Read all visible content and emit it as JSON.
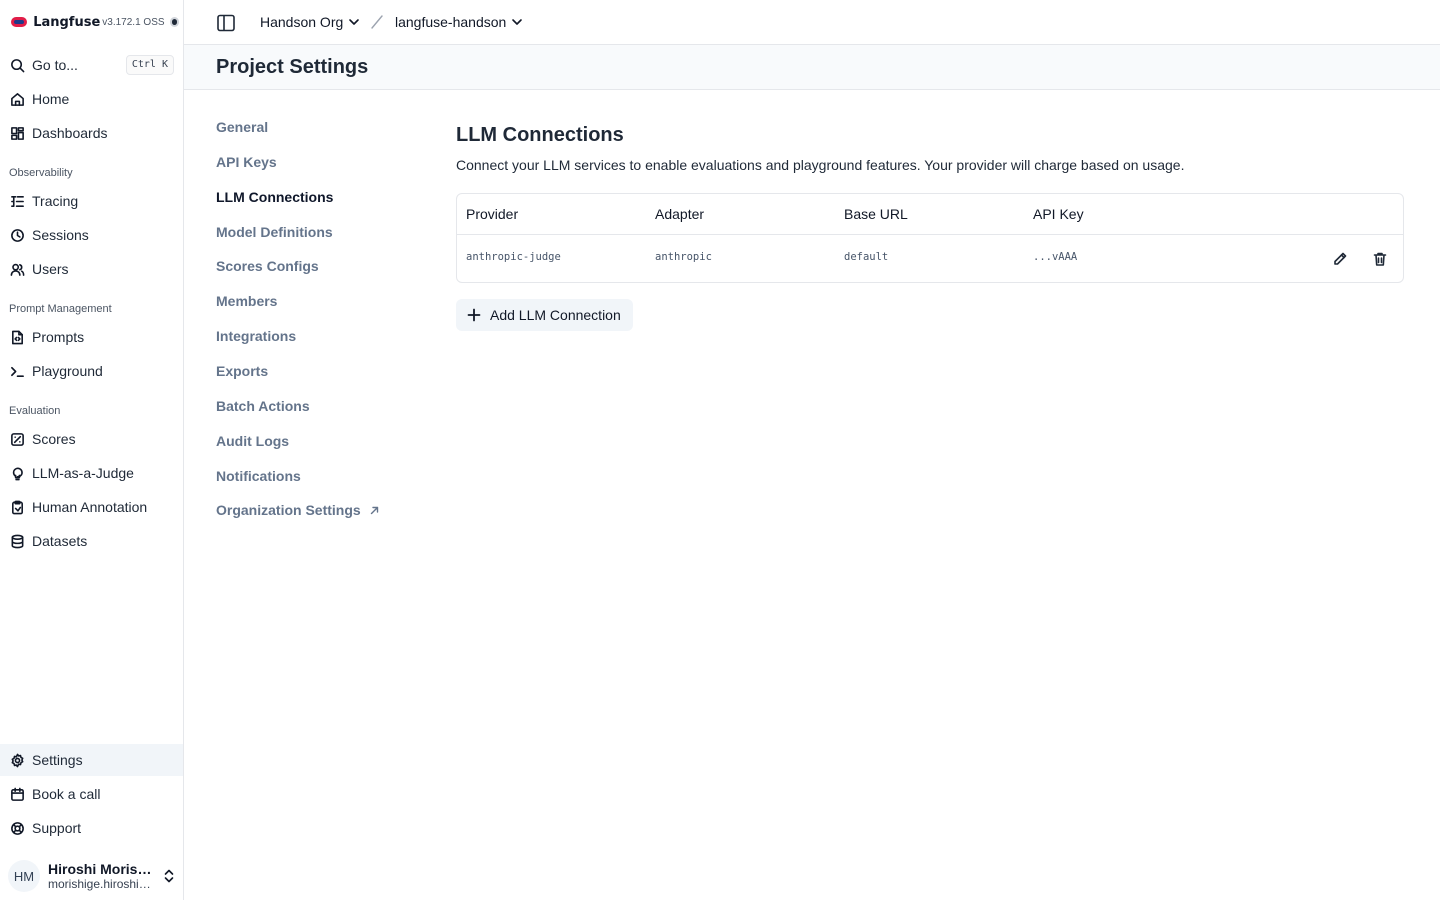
{
  "brand": {
    "name": "Langfuse",
    "version": "v3.172.1 OSS"
  },
  "sidebar": {
    "goto": {
      "label": "Go to...",
      "shortcut": "Ctrl K"
    },
    "top_items": [
      {
        "label": "Home",
        "icon": "home-icon"
      },
      {
        "label": "Dashboards",
        "icon": "dashboard-icon"
      }
    ],
    "sections": [
      {
        "label": "Observability",
        "items": [
          {
            "label": "Tracing",
            "icon": "tracing-icon"
          },
          {
            "label": "Sessions",
            "icon": "clock-icon"
          },
          {
            "label": "Users",
            "icon": "users-icon"
          }
        ]
      },
      {
        "label": "Prompt Management",
        "items": [
          {
            "label": "Prompts",
            "icon": "file-code-icon"
          },
          {
            "label": "Playground",
            "icon": "terminal-icon"
          }
        ]
      },
      {
        "label": "Evaluation",
        "items": [
          {
            "label": "Scores",
            "icon": "score-icon"
          },
          {
            "label": "LLM-as-a-Judge",
            "icon": "lightbulb-icon"
          },
          {
            "label": "Human Annotation",
            "icon": "clipboard-icon"
          },
          {
            "label": "Datasets",
            "icon": "database-icon"
          }
        ]
      }
    ],
    "bottom_items": [
      {
        "label": "Settings",
        "icon": "gear-icon",
        "active": true
      },
      {
        "label": "Book a call",
        "icon": "calendar-icon"
      },
      {
        "label": "Support",
        "icon": "lifebuoy-icon"
      }
    ],
    "user": {
      "initials": "HM",
      "name": "Hiroshi Morishige",
      "email": "morishige.hiroshi@example.com"
    }
  },
  "topbar": {
    "org": "Handson Org",
    "project": "langfuse-handson"
  },
  "page": {
    "title": "Project Settings"
  },
  "settings_menu": [
    {
      "label": "General"
    },
    {
      "label": "API Keys"
    },
    {
      "label": "LLM Connections",
      "active": true
    },
    {
      "label": "Model Definitions"
    },
    {
      "label": "Scores Configs"
    },
    {
      "label": "Members"
    },
    {
      "label": "Integrations"
    },
    {
      "label": "Exports"
    },
    {
      "label": "Batch Actions"
    },
    {
      "label": "Audit Logs"
    },
    {
      "label": "Notifications"
    },
    {
      "label": "Organization Settings",
      "external": true
    }
  ],
  "llm_connections": {
    "title": "LLM Connections",
    "description": "Connect your LLM services to enable evaluations and playground features. Your provider will charge based on usage.",
    "columns": [
      "Provider",
      "Adapter",
      "Base URL",
      "API Key"
    ],
    "rows": [
      {
        "provider": "anthropic-judge",
        "adapter": "anthropic",
        "base_url": "default",
        "api_key": "...vAAA"
      }
    ],
    "add_button": "Add LLM Connection"
  }
}
